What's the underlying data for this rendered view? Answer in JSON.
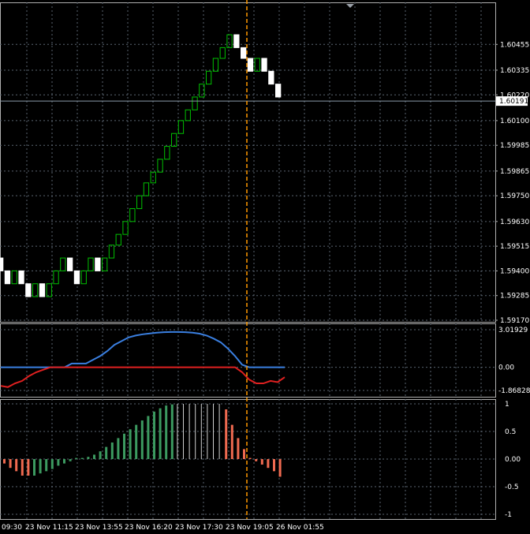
{
  "colors": {
    "background": "#000000",
    "grid": "#5a6470",
    "frame": "#b0b0b0",
    "text": "#ffffff",
    "renko_up": "#00c000",
    "renko_down": "#ffffff",
    "renko_down_border": "#ffffff",
    "bid_line": "#8a9aa8",
    "crosshair": "#ff9900",
    "indicator_blue": "#3a7fe0",
    "indicator_red": "#e02020",
    "hist_green": "#3c9a60",
    "hist_red": "#ef6a50",
    "hist_white": "#cfcfcf"
  },
  "current_price_label": "1.60191",
  "chart_data": [
    {
      "type": "renko",
      "panel": "price",
      "ylim": [
        1.5917,
        1.6057
      ],
      "yticks": [
        "1.60455",
        "1.60335",
        "1.60220",
        "1.60100",
        "1.59985",
        "1.59865",
        "1.59750",
        "1.59630",
        "1.59515",
        "1.59400",
        "1.59285",
        "1.59170"
      ],
      "box_size": 0.00058,
      "bricks": [
        {
          "o": 1.5946,
          "c": 1.594
        },
        {
          "o": 1.594,
          "c": 1.5934
        },
        {
          "o": 1.5934,
          "c": 1.594
        },
        {
          "o": 1.594,
          "c": 1.5934
        },
        {
          "o": 1.5934,
          "c": 1.5928
        },
        {
          "o": 1.5928,
          "c": 1.5934
        },
        {
          "o": 1.5934,
          "c": 1.5928
        },
        {
          "o": 1.5928,
          "c": 1.5934
        },
        {
          "o": 1.5934,
          "c": 1.594
        },
        {
          "o": 1.594,
          "c": 1.5946
        },
        {
          "o": 1.5946,
          "c": 1.594
        },
        {
          "o": 1.594,
          "c": 1.5934
        },
        {
          "o": 1.5934,
          "c": 1.594
        },
        {
          "o": 1.594,
          "c": 1.5946
        },
        {
          "o": 1.5946,
          "c": 1.594
        },
        {
          "o": 1.594,
          "c": 1.5946
        },
        {
          "o": 1.5946,
          "c": 1.5952
        },
        {
          "o": 1.5952,
          "c": 1.5957
        },
        {
          "o": 1.5957,
          "c": 1.5963
        },
        {
          "o": 1.5963,
          "c": 1.5969
        },
        {
          "o": 1.5969,
          "c": 1.5975
        },
        {
          "o": 1.5975,
          "c": 1.5981
        },
        {
          "o": 1.5981,
          "c": 1.5986
        },
        {
          "o": 1.5986,
          "c": 1.5992
        },
        {
          "o": 1.5992,
          "c": 1.5998
        },
        {
          "o": 1.5998,
          "c": 1.6004
        },
        {
          "o": 1.6004,
          "c": 1.601
        },
        {
          "o": 1.601,
          "c": 1.6015
        },
        {
          "o": 1.6015,
          "c": 1.6021
        },
        {
          "o": 1.6021,
          "c": 1.6027
        },
        {
          "o": 1.6027,
          "c": 1.6033
        },
        {
          "o": 1.6033,
          "c": 1.6039
        },
        {
          "o": 1.6039,
          "c": 1.6044
        },
        {
          "o": 1.6044,
          "c": 1.605
        },
        {
          "o": 1.605,
          "c": 1.6044
        },
        {
          "o": 1.6044,
          "c": 1.6039
        },
        {
          "o": 1.6039,
          "c": 1.6033
        },
        {
          "o": 1.6033,
          "c": 1.6039
        },
        {
          "o": 1.6039,
          "c": 1.6033
        },
        {
          "o": 1.6033,
          "c": 1.6027
        },
        {
          "o": 1.6027,
          "c": 1.6021
        }
      ],
      "current_price": 1.60191
    },
    {
      "type": "line",
      "panel": "oscillator",
      "ylim": [
        -1.8682,
        3.01929
      ],
      "yticks": [
        "3.01929",
        "0.00",
        "-1.86828"
      ],
      "series": [
        {
          "color": "#3a7fe0",
          "values": [
            0,
            0,
            0,
            0,
            0,
            0,
            0,
            0,
            0,
            0,
            0.3,
            0.3,
            0.3,
            0.6,
            0.9,
            1.3,
            1.8,
            2.1,
            2.4,
            2.55,
            2.65,
            2.72,
            2.78,
            2.82,
            2.84,
            2.84,
            2.82,
            2.78,
            2.7,
            2.55,
            2.3,
            2.0,
            1.5,
            0.9,
            0.2,
            0,
            0,
            0,
            0,
            0,
            0
          ]
        },
        {
          "color": "#e02020",
          "values": [
            -1.5,
            -1.6,
            -1.3,
            -1.1,
            -0.7,
            -0.4,
            -0.2,
            0,
            0,
            0,
            0,
            0,
            0,
            0,
            0,
            0,
            0,
            0,
            0,
            0,
            0,
            0,
            0,
            0,
            0,
            0,
            0,
            0,
            0,
            0,
            0,
            0,
            0,
            0,
            -0.4,
            -1.0,
            -1.3,
            -1.3,
            -1.1,
            -1.2,
            -0.8
          ]
        }
      ]
    },
    {
      "type": "bar",
      "panel": "histogram",
      "ylim": [
        -1,
        1
      ],
      "yticks": [
        "1",
        "0.5",
        "0.00",
        "-0.5",
        "-1"
      ],
      "values": [
        -0.08,
        -0.16,
        -0.22,
        -0.3,
        -0.3,
        -0.3,
        -0.26,
        -0.22,
        -0.18,
        -0.12,
        -0.08,
        -0.04,
        0.02,
        0.02,
        0.04,
        0.08,
        0.14,
        0.22,
        0.3,
        0.38,
        0.46,
        0.54,
        0.62,
        0.7,
        0.78,
        0.86,
        0.92,
        0.97,
        0.99,
        1.0,
        1.0,
        1.0,
        1.0,
        1.0,
        1.0,
        1.0,
        1.0,
        0.9,
        0.62,
        0.38,
        0.18,
        0.02,
        -0.04,
        -0.1,
        -0.16,
        -0.22,
        -0.32
      ],
      "colors": [
        "r",
        "r",
        "r",
        "r",
        "r",
        "g",
        "g",
        "g",
        "g",
        "g",
        "g",
        "g",
        "g",
        "g",
        "g",
        "g",
        "g",
        "g",
        "g",
        "g",
        "g",
        "g",
        "g",
        "g",
        "g",
        "g",
        "g",
        "g",
        "g",
        "w",
        "w",
        "w",
        "w",
        "w",
        "w",
        "w",
        "w",
        "r",
        "r",
        "r",
        "r",
        "r",
        "r",
        "r",
        "r",
        "r",
        "r"
      ]
    }
  ],
  "time_axis": [
    "09:30",
    "23 Nov 11:15",
    "23 Nov 13:55",
    "23 Nov 16:20",
    "23 Nov 17:30",
    "23 Nov 19:05",
    "26 Nov 01:55"
  ]
}
